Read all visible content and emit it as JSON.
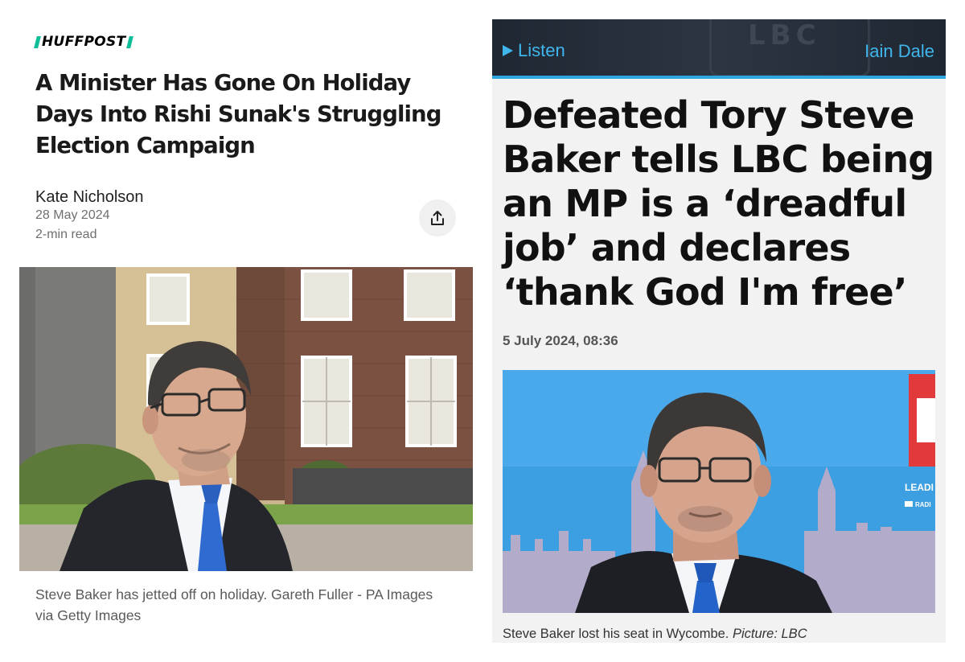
{
  "left_article": {
    "brand": "HUFFPOST",
    "headline": "A Minister Has Gone On Holiday Days Into Rishi Sunak's Struggling Election Campaign",
    "author": "Kate Nicholson",
    "date": "28 May 2024",
    "read_time": "2-min read",
    "share_icon": "share-icon",
    "caption": "Steve Baker has jetted off on holiday. Gareth Fuller - PA Images via Getty Images",
    "accent_color": "#0dbe98"
  },
  "right_article": {
    "listen_label": "Listen",
    "host": "Iain Dale",
    "bar_logo": "LBC",
    "headline": "Defeated Tory Steve Baker tells LBC being an MP is a ‘dreadful job’ and declares ‘thank God I'm free’",
    "date": "5 July 2024, 08:36",
    "caption_text": "Steve Baker lost his seat in Wycombe.",
    "caption_credit": "Picture: LBC",
    "screen_text_1": "LEADI",
    "screen_text_2": "RADI",
    "accent_color": "#3fb6ec"
  }
}
